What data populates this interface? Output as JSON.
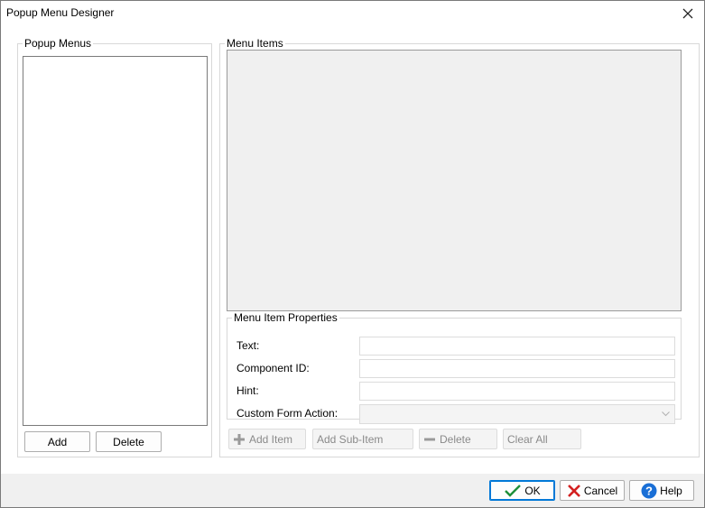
{
  "window": {
    "title": "Popup Menu Designer"
  },
  "popup_menus": {
    "legend": "Popup Menus",
    "items": [],
    "add_label": "Add",
    "delete_label": "Delete"
  },
  "menu_items": {
    "legend": "Menu Items",
    "items": [],
    "properties": {
      "legend": "Menu Item Properties",
      "text_label": "Text:",
      "text_value": "",
      "component_id_label": "Component ID:",
      "component_id_value": "",
      "hint_label": "Hint:",
      "hint_value": "",
      "custom_form_action_label": "Custom Form Action:",
      "custom_form_action_value": ""
    },
    "toolbar": {
      "add_item_label": "Add Item",
      "add_sub_item_label": "Add Sub-Item",
      "delete_label": "Delete",
      "clear_all_label": "Clear All"
    }
  },
  "footer": {
    "ok_label": "OK",
    "cancel_label": "Cancel",
    "help_label": "Help"
  },
  "colors": {
    "accent": "#0078d7",
    "ok_check": "#1e8f3a",
    "cancel_x": "#d32020",
    "help_blue": "#1a6fd6"
  },
  "icons": {
    "close": "close-icon",
    "add_item": "plus-icon",
    "delete": "minus-icon",
    "ok": "checkmark-icon",
    "cancel": "x-icon",
    "help": "help-icon"
  }
}
